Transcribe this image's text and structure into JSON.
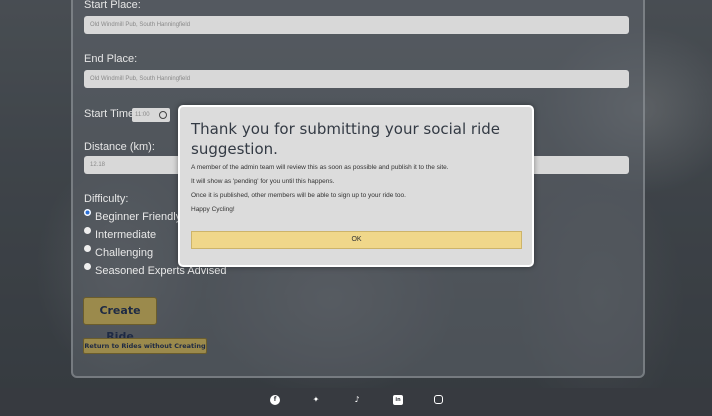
{
  "form": {
    "start_place_label": "Start Place:",
    "start_place_value": "Old Windmill Pub, South Hanningfield",
    "end_place_label": "End Place:",
    "end_place_value": "Old Windmill Pub, South Hanningfield",
    "start_time_label": "Start Time:",
    "start_time_value": "11:00",
    "distance_label": "Distance (km):",
    "distance_value": "12.18",
    "difficulty_label": "Difficulty:",
    "difficulty_options": [
      "Beginner Friendly",
      "Intermediate",
      "Challenging",
      "Seasoned Experts Advised"
    ],
    "difficulty_selected": "Beginner Friendly",
    "create_button": "Create Ride",
    "return_button": "Return to Rides without Creating"
  },
  "modal": {
    "title": "Thank you for submitting your social ride suggestion.",
    "lines": [
      "A member of the admin team will review this as soon as possible and publish it to the site.",
      "It will show as 'pending' for you until this happens.",
      "Once it is published, other members will be able to sign up to your ride too.",
      "Happy Cycling!"
    ],
    "ok_button": "OK"
  },
  "footer": {
    "icons": [
      "facebook-icon",
      "twitter-icon",
      "tiktok-icon",
      "linkedin-icon",
      "instagram-icon"
    ]
  },
  "colors": {
    "accent_button": "#9b8a4c",
    "modal_ok": "#f0d78a",
    "footer": "#373a40"
  }
}
